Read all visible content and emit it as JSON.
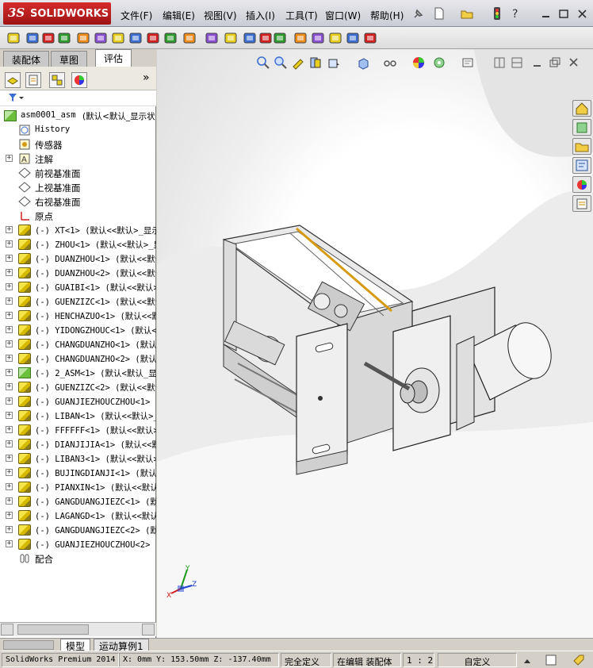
{
  "app": {
    "logo_ds": "3S",
    "logo_text": "SOLIDWORKS"
  },
  "menu": [
    "文件(F)",
    "编辑(E)",
    "视图(V)",
    "插入(I)",
    "工具(T)",
    "窗口(W)",
    "帮助(H)"
  ],
  "toolbar_icons": [
    "smart-dimension",
    "assembly-feature",
    "mate",
    "linear-pattern",
    "smart-fasteners",
    "move-component",
    "show-hidden",
    "assembly-features",
    "reference-geometry",
    "new-motion-study",
    "bill-of-materials",
    "exploded-view",
    "explode-line",
    "interference-detection",
    "clearance-verification",
    "hole-alignment",
    "measure",
    "mass-properties",
    "section-properties",
    "check",
    "appearance"
  ],
  "panel": {
    "tabs": [
      "装配体",
      "草图",
      "评估"
    ],
    "active_tab": "评估",
    "expand_glyph": "»"
  },
  "tree": {
    "root": "asm0001_asm",
    "root_config": "(默认<默认_显示状",
    "fixed_items": [
      {
        "label": "History",
        "icon": "history-icon"
      },
      {
        "label": "传感器",
        "icon": "sensor-icon"
      },
      {
        "label": "注解",
        "icon": "annotation-icon"
      },
      {
        "label": "前视基准面",
        "icon": "plane-icon"
      },
      {
        "label": "上视基准面",
        "icon": "plane-icon"
      },
      {
        "label": "右视基准面",
        "icon": "plane-icon"
      },
      {
        "label": "原点",
        "icon": "origin-icon"
      }
    ],
    "components": [
      "(-) XT<1> (默认<<默认>_显示",
      "(-) ZHOU<1> (默认<<默认>_显",
      "(-) DUANZHOU<1> (默认<<默认",
      "(-) DUANZHOU<2> (默认<<默认",
      "(-) GUAIBI<1> (默认<<默认>",
      "(-) GUENZIZC<1> (默认<<默认",
      "(-) HENCHAZUO<1> (默认<<默认",
      "(-) YIDONGZHOUC<1> (默认<<默",
      "(-) CHANGDUANZHO<1> (默认<<",
      "(-) CHANGDUANZHO<2> (默认<<",
      "(-) 2_ASM<1> (默认<默认_显",
      "(-) GUENZIZC<2> (默认<<默认",
      "(-) GUANJIEZHOUCZHOU<1> (默",
      "(-) LIBAN<1> (默认<<默认>_",
      "(-) FFFFFF<1> (默认<<默认>_",
      "(-) DIANJIJIA<1> (默认<<默",
      "(-) LIBAN3<1> (默认<<默认>",
      "(-) BUJINGDIANJI<1> (默认",
      "(-) PIANXIN<1> (默认<<默认",
      "(-) GANGDUANGJIEZC<1> (默认",
      "(-) LAGANGD<1> (默认<<默认",
      "(-) GANGDUANGJIEZC<2> (默认",
      "(-) GUANJIEZHOUCZHOU<2> (默"
    ],
    "mates_label": "配合"
  },
  "bottom_tabs": [
    "模型",
    "运动算例1"
  ],
  "status": {
    "product": "SolidWorks Premium 2014",
    "coords": "X: 0mm Y: 153.50mm Z: -137.40mm",
    "defined": "完全定义",
    "mode": "在编辑 装配体",
    "scale": "1 : 2",
    "units": "自定义"
  },
  "triad_labels": {
    "x": "X",
    "y": "Y",
    "z": "Z"
  },
  "colors": {
    "logo_red": "#c21f1f",
    "part_yellow": "#e8cf1f",
    "motor": "#f0f0f0",
    "belt": "#d69a12"
  }
}
